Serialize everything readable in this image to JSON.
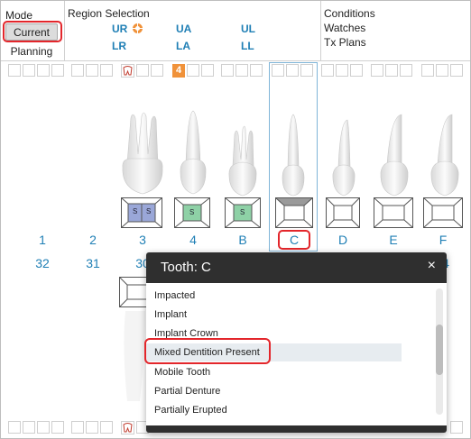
{
  "header": {
    "mode_title": "Mode",
    "mode_current": "Current",
    "mode_planning": "Planning",
    "region_title": "Region Selection",
    "regions": {
      "ur": "UR",
      "ua": "UA",
      "ul": "UL",
      "lr": "LR",
      "la": "LA",
      "ll": "LL"
    },
    "conditions": "Conditions",
    "watches": "Watches",
    "tx_plans": "Tx Plans"
  },
  "top_badge": "4",
  "teeth_upper": [
    {
      "label": "1",
      "lower": "32"
    },
    {
      "label": "2",
      "lower": "31"
    },
    {
      "label": "3",
      "lower": "30"
    },
    {
      "label": "4",
      "lower": ""
    },
    {
      "label": "B",
      "lower": ""
    },
    {
      "label": "C",
      "lower": ""
    },
    {
      "label": "D",
      "lower": ""
    },
    {
      "label": "E",
      "lower": ""
    },
    {
      "label": "F",
      "lower": "4"
    }
  ],
  "surface_mark": "S",
  "popup": {
    "title": "Tooth: C",
    "close": "×",
    "items": [
      "Impacted",
      "Implant",
      "Implant Crown",
      "Mixed Dentition Present",
      "Mobile Tooth",
      "Partial Denture",
      "Partially Erupted"
    ],
    "highlighted": "Mixed Dentition Present"
  },
  "colors": {
    "accent_blue": "#1f7fb5",
    "highlight_red": "#e3262b",
    "surface_blue": "#9aa7d8",
    "surface_green": "#8ed1a6",
    "badge_orange": "#f0923a",
    "popup_header": "#2f2f2f"
  }
}
